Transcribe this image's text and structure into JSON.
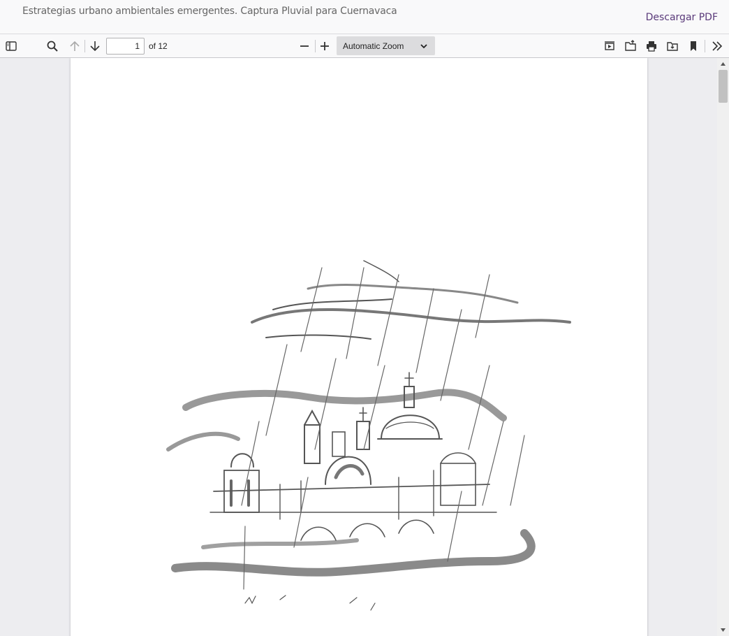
{
  "header": {
    "title": "Estrategias urbano ambientales emergentes. Captura Pluvial para Cuernavaca",
    "download_label": "Descargar PDF"
  },
  "toolbar": {
    "current_page": "1",
    "page_count_label": "of 12",
    "zoom_label": "Automatic Zoom",
    "icons": [
      "sidebar-toggle-icon",
      "search-icon",
      "arrow-up-icon",
      "arrow-down-icon",
      "minus-icon",
      "plus-icon",
      "presentation-icon",
      "open-file-icon",
      "print-icon",
      "save-icon",
      "bookmark-icon",
      "double-chevron-right-icon"
    ]
  },
  "colors": {
    "link": "#5a3a7a",
    "toolbar_bg": "#f9f9fa",
    "viewer_bg": "#ededf0"
  }
}
